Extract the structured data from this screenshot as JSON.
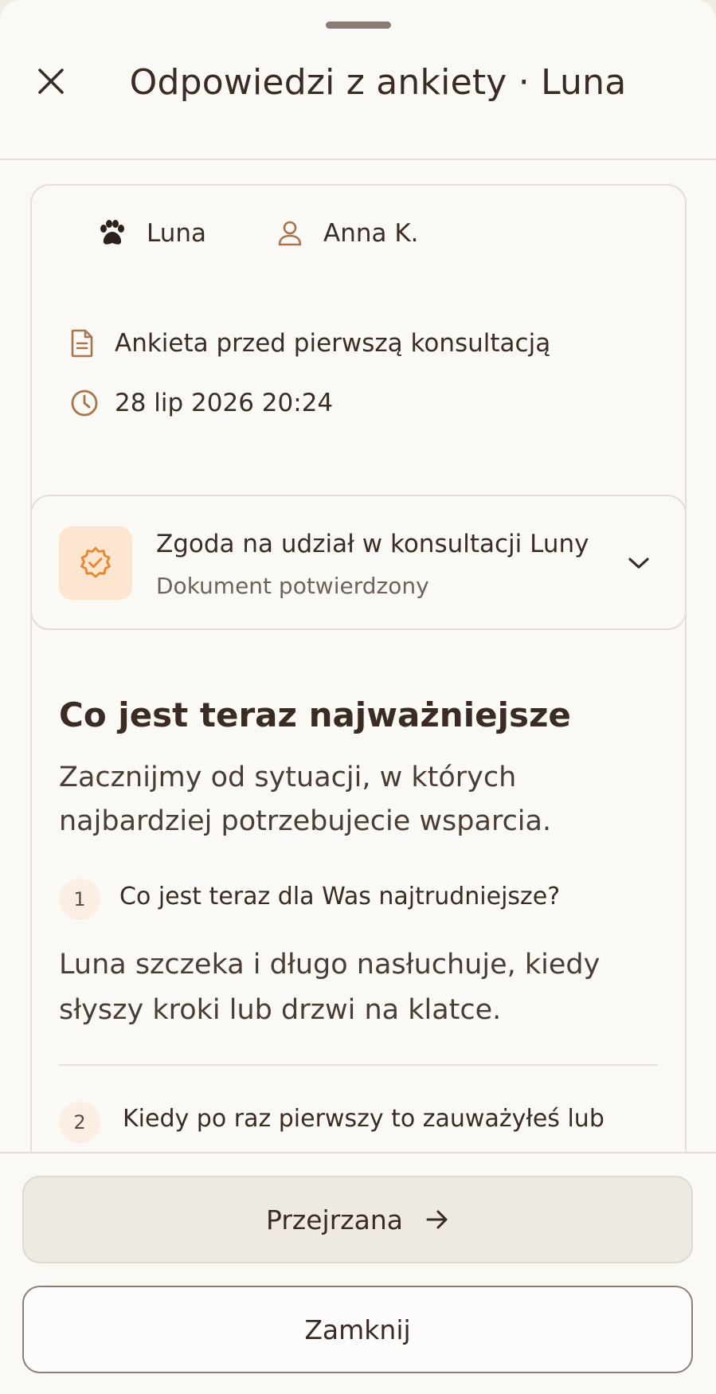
{
  "header": {
    "title": "Odpowiedzi z ankiety · Luna",
    "close_icon": "close-icon"
  },
  "meta": {
    "pet_name": "Luna",
    "owner_name": "Anna K.",
    "form_name": "Ankieta przed pierwszą konsultacją",
    "submitted_at": "28 lip 2026 20:24"
  },
  "consent": {
    "title": "Zgoda na udział w konsultacji Luny",
    "status": "Dokument potwierdzony",
    "accent_color": "#e8862c"
  },
  "section": {
    "title": "Co jest teraz najważniejsze",
    "description": "Zacznijmy od sytuacji, w których najbardziej potrzebujecie wsparcia."
  },
  "questions": [
    {
      "number": "1",
      "question": "Co jest teraz dla Was najtrudniejsze?",
      "answer": "Luna szczeka i długo nasłuchuje, kiedy słyszy kroki lub drzwi na klatce."
    },
    {
      "number": "2",
      "question": "Kiedy po raz pierwszy to zauważyłeś lub"
    }
  ],
  "footer": {
    "reviewed_label": "Przejrzana",
    "close_label": "Zamknij"
  }
}
